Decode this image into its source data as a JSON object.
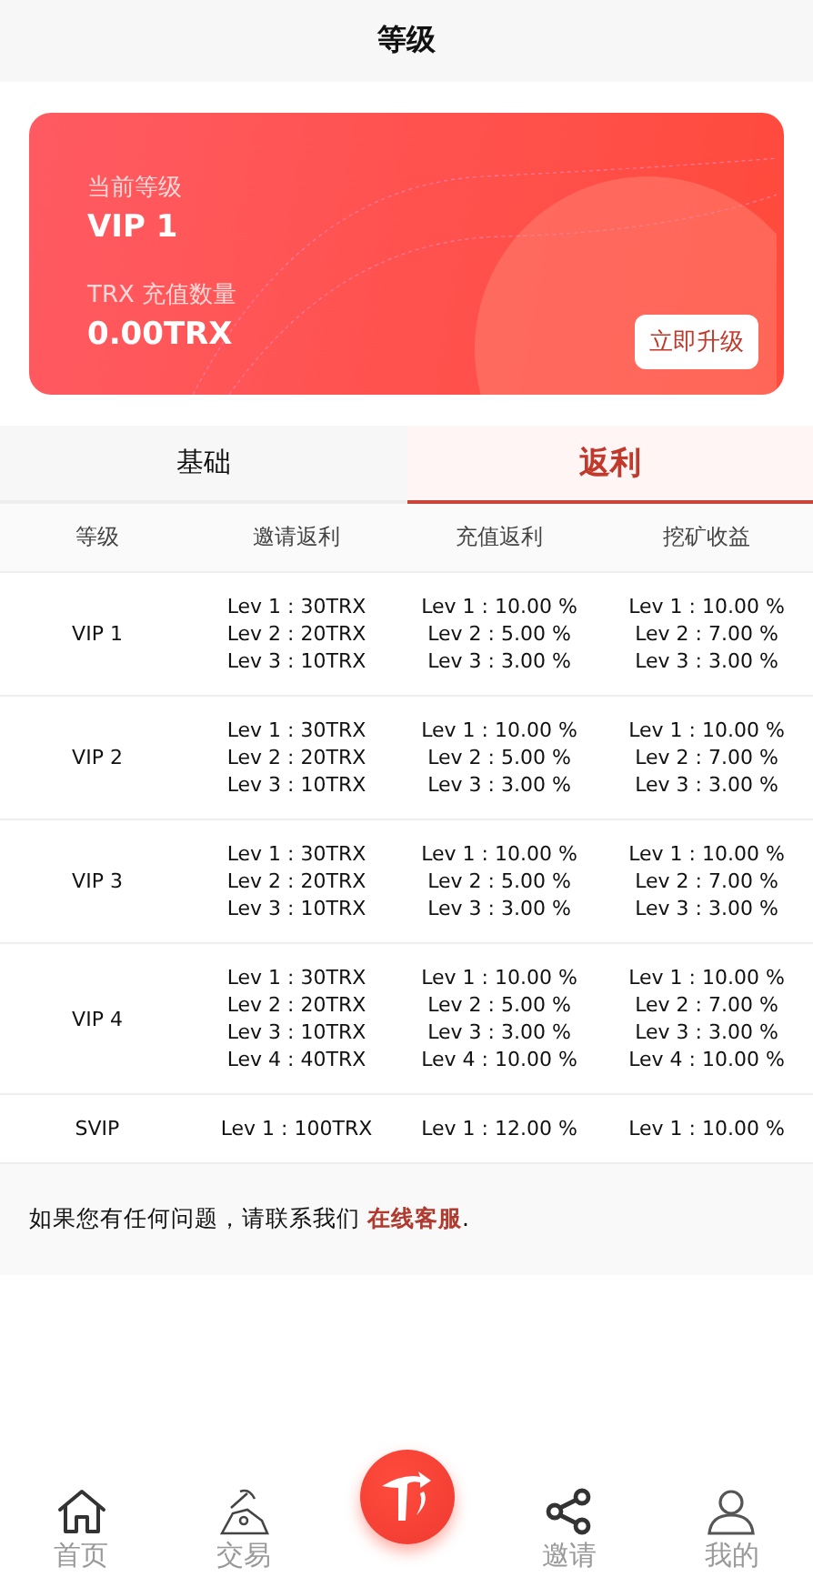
{
  "header": {
    "title": "等级"
  },
  "level_card": {
    "level_label": "当前等级",
    "level": "VIP 1",
    "balance_label": "TRX 充值数量",
    "balance": "0.00TRX",
    "upgrade_button": "立即升级"
  },
  "tabs": [
    {
      "label": "基础",
      "selected": false
    },
    {
      "label": "返利",
      "selected": true
    }
  ],
  "table": {
    "columns": [
      "等级",
      "邀请返利",
      "充值返利",
      "挖矿收益"
    ],
    "rows": [
      {
        "level": "VIP 1",
        "invite": [
          "Lev 1 : 30TRX",
          "Lev 2 : 20TRX",
          "Lev 3 : 10TRX"
        ],
        "recharge": [
          "Lev 1 : 10.00 %",
          "Lev 2 : 5.00 %",
          "Lev 3 : 3.00 %"
        ],
        "mining": [
          "Lev 1 : 10.00 %",
          "Lev 2 : 7.00 %",
          "Lev 3 : 3.00 %"
        ]
      },
      {
        "level": "VIP 2",
        "invite": [
          "Lev 1 : 30TRX",
          "Lev 2 : 20TRX",
          "Lev 3 : 10TRX"
        ],
        "recharge": [
          "Lev 1 : 10.00 %",
          "Lev 2 : 5.00 %",
          "Lev 3 : 3.00 %"
        ],
        "mining": [
          "Lev 1 : 10.00 %",
          "Lev 2 : 7.00 %",
          "Lev 3 : 3.00 %"
        ]
      },
      {
        "level": "VIP 3",
        "invite": [
          "Lev 1 : 30TRX",
          "Lev 2 : 20TRX",
          "Lev 3 : 10TRX"
        ],
        "recharge": [
          "Lev 1 : 10.00 %",
          "Lev 2 : 5.00 %",
          "Lev 3 : 3.00 %"
        ],
        "mining": [
          "Lev 1 : 10.00 %",
          "Lev 2 : 7.00 %",
          "Lev 3 : 3.00 %"
        ]
      },
      {
        "level": "VIP 4",
        "invite": [
          "Lev 1 : 30TRX",
          "Lev 2 : 20TRX",
          "Lev 3 : 10TRX",
          "Lev 4 : 40TRX"
        ],
        "recharge": [
          "Lev 1 : 10.00 %",
          "Lev 2 : 5.00 %",
          "Lev 3 : 3.00 %",
          "Lev 4 : 10.00 %"
        ],
        "mining": [
          "Lev 1 : 10.00 %",
          "Lev 2 : 7.00 %",
          "Lev 3 : 3.00 %",
          "Lev 4 : 10.00 %"
        ]
      },
      {
        "level": "SVIP",
        "invite": [
          "Lev 1 : 100TRX"
        ],
        "recharge": [
          "Lev 1 : 12.00 %"
        ],
        "mining": [
          "Lev 1 : 10.00 %"
        ]
      }
    ]
  },
  "help": {
    "text": "如果您有任何问题，请联系我们",
    "link": "在线客服",
    "end": "."
  },
  "nav": [
    {
      "kind": "home",
      "label": "首页"
    },
    {
      "kind": "trade",
      "label": "交易"
    },
    {
      "kind": "center"
    },
    {
      "kind": "invite",
      "label": "邀请"
    },
    {
      "kind": "profile",
      "label": "我的"
    }
  ]
}
